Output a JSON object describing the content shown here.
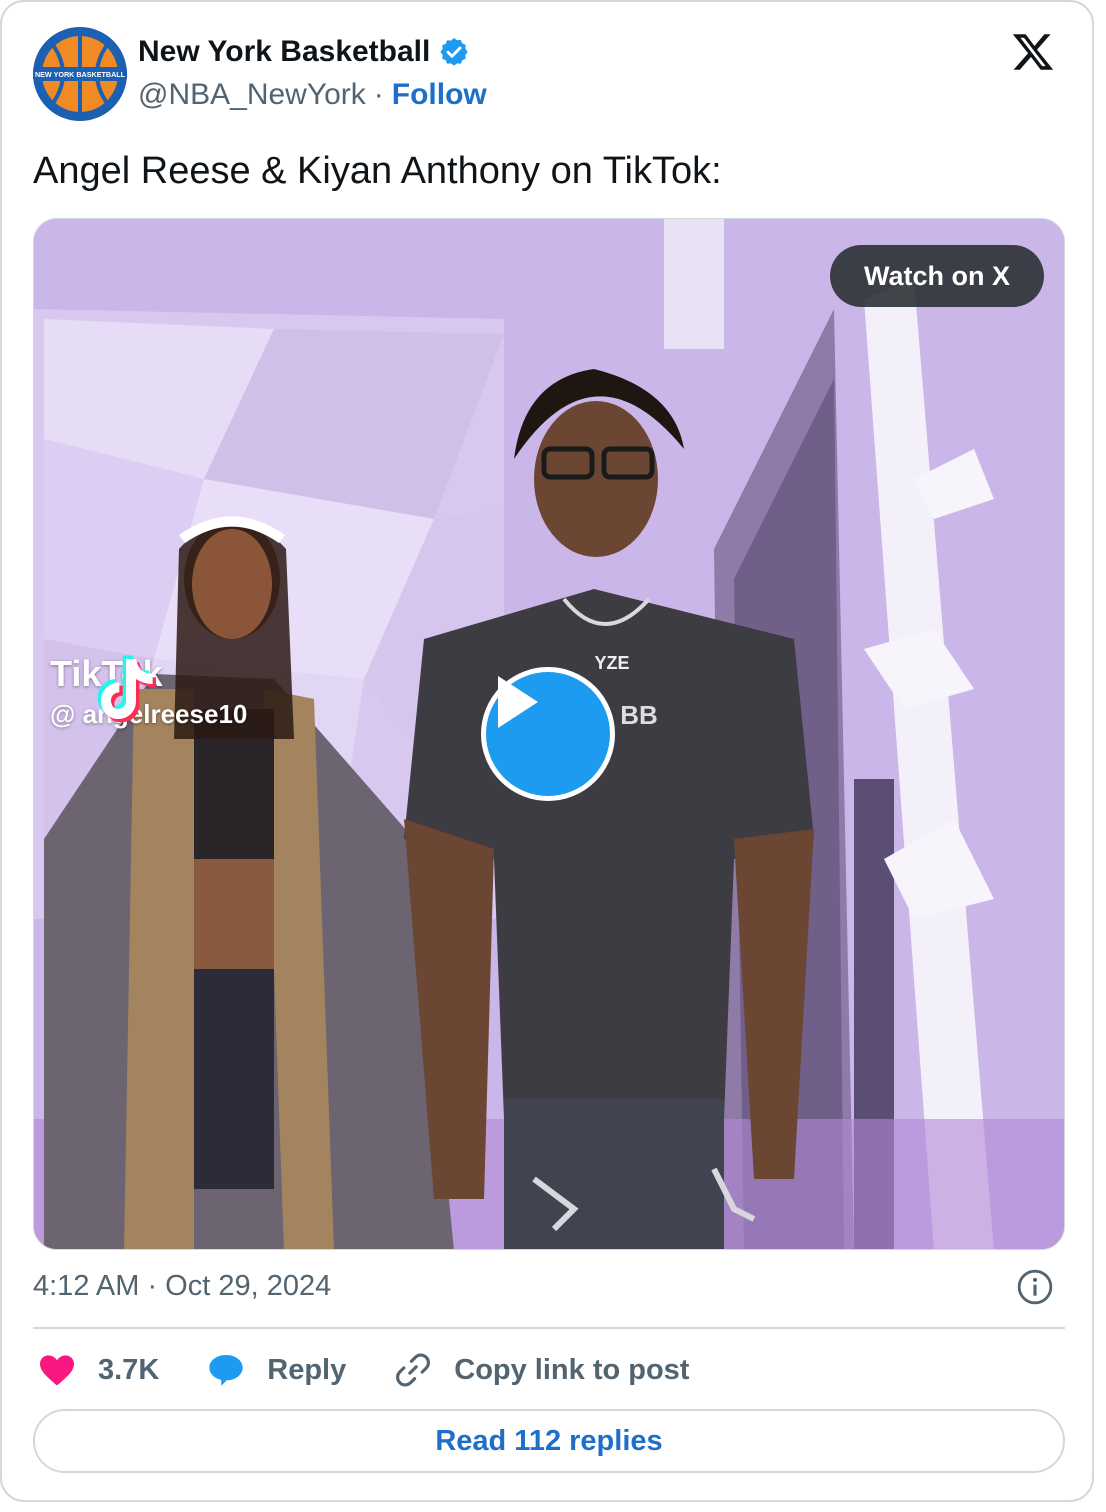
{
  "author": {
    "name": "New York Basketball",
    "handle": "@NBA_NewYork",
    "separator": "·",
    "follow_label": "Follow",
    "avatar_text": "NEW YORK BASKETBALL",
    "verified_icon": "verified-badge-icon"
  },
  "tweet": {
    "text": "Angel Reese & Kiyan Anthony on TikTok:",
    "timestamp": "4:12 AM · Oct 29, 2024"
  },
  "media": {
    "watch_label": "Watch on X",
    "tiktok_brand": "TikTok",
    "tiktok_user": "@ angelreese10",
    "chain_text": "YZE",
    "shirt_text": "BB"
  },
  "actions": {
    "likes": "3.7K",
    "reply_label": "Reply",
    "copy_label": "Copy link to post",
    "read_replies_label": "Read 112 replies"
  },
  "colors": {
    "accent": "#1d6fc9",
    "like": "#f91880",
    "reply": "#1d9bf0",
    "muted": "#536471",
    "border": "#cfd9de"
  }
}
